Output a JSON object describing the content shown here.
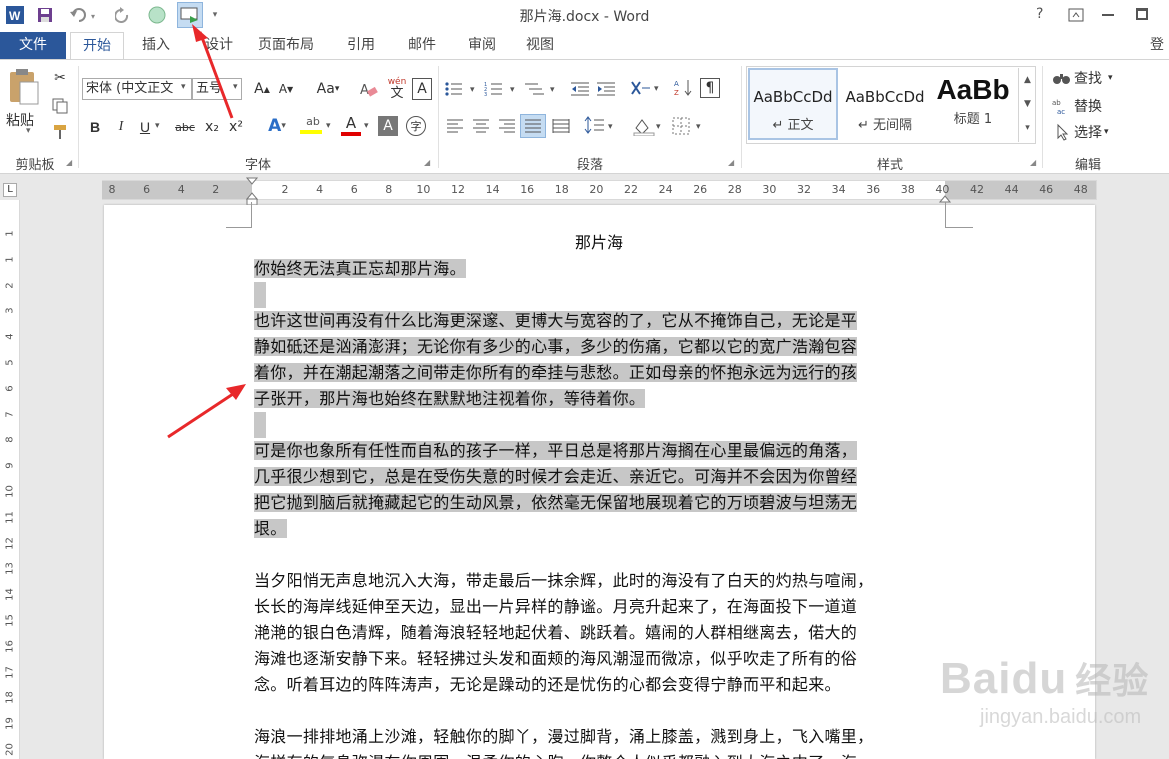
{
  "window": {
    "title": "那片海.docx - Word",
    "help": "?",
    "accent": "#2b579a"
  },
  "tabs": {
    "file": "文件",
    "home": "开始",
    "insert": "插入",
    "design": "设计",
    "layout": "页面布局",
    "references": "引用",
    "mailings": "邮件",
    "review": "审阅",
    "view": "视图",
    "signin": "登"
  },
  "ribbon": {
    "clipboard": {
      "paste": "粘贴",
      "label": "剪贴板"
    },
    "font": {
      "name": "宋体 (中文正文",
      "size": "五号",
      "label": "字体",
      "case_btn": "Aa",
      "wen": "wén",
      "wen_char": "文",
      "boxed_char": "A",
      "enclose_char": "字",
      "bold": "B",
      "italic": "I",
      "underline": "U",
      "strike": "abc",
      "subscript": "x₂",
      "superscript": "x²",
      "effects": "A",
      "highlight": "ab",
      "color": "A",
      "shading": "A",
      "grow": "A",
      "shrink": "A"
    },
    "paragraph": {
      "label": "段落"
    },
    "styles": {
      "label": "样式",
      "items": [
        {
          "sample": "AaBbCcDd",
          "name": "↵ 正文"
        },
        {
          "sample": "AaBbCcDd",
          "name": "↵ 无间隔"
        },
        {
          "sample": "AaBb",
          "name": "标题 1"
        }
      ]
    },
    "editing": {
      "label": "编辑",
      "find": "查找",
      "replace": "替换",
      "select": "选择"
    }
  },
  "ruler": {
    "corner": "L",
    "numbers": [
      "8",
      "6",
      "4",
      "2",
      "2",
      "4",
      "6",
      "8",
      "10",
      "12",
      "14",
      "16",
      "18",
      "20",
      "22",
      "24",
      "26",
      "28",
      "30",
      "32",
      "34",
      "36",
      "38",
      "40",
      "42",
      "44",
      "46",
      "48"
    ],
    "vnumbers": [
      "1",
      "1",
      "2",
      "3",
      "4",
      "5",
      "6",
      "7",
      "8",
      "9",
      "10",
      "11",
      "12",
      "13",
      "14",
      "15",
      "16",
      "17",
      "18",
      "19",
      "20"
    ]
  },
  "document": {
    "title": "那片海",
    "paragraphs": [
      [
        "你始终无法真正忘却那片海。"
      ],
      [
        "也许这世间再没有什么比海更深邃、更博大与宽容的了，它从不掩饰自己，无论是平",
        "静如砥还是汹涌澎湃；无论你有多少的心事，多少的伤痛，它都以它的宽广浩瀚包容",
        "着你，并在潮起潮落之间带走你所有的牵挂与悲愁。正如母亲的怀抱永远为远行的孩",
        "子张开，那片海也始终在默默地注视着你，等待着你。"
      ],
      [
        "可是你也象所有任性而自私的孩子一样，平日总是将那片海搁在心里最偏远的角落，",
        "几乎很少想到它，总是在受伤失意的时候才会走近、亲近它。可海并不会因为你曾经",
        "把它抛到脑后就掩藏起它的生动风景，依然毫无保留地展现着它的万顷碧波与坦荡无",
        "垠。"
      ],
      [
        "当夕阳悄无声息地沉入大海，带走最后一抹余辉，此时的海没有了白天的灼热与喧闹，",
        "长长的海岸线延伸至天边，显出一片异样的静谧。月亮升起来了，在海面投下一道道",
        "滟滟的银白色清辉，随着海浪轻轻地起伏着、跳跃着。嬉闹的人群相继离去，偌大的",
        "海滩也逐渐安静下来。轻轻拂过头发和面颊的海风潮湿而微凉，似乎吹走了所有的俗",
        "念。听着耳边的阵阵涛声，无论是躁动的还是忧伤的心都会变得宁静而平和起来。"
      ],
      [
        "海浪一排排地涌上沙滩，轻触你的脚丫，漫过脚背，涌上膝盖，溅到身上，飞入嘴里，",
        "海样有的气息弥漫在你周围，温柔你的心胸，你整个人似乎都融入到大海之中了。海"
      ]
    ]
  },
  "watermark": {
    "brand": "Baidu",
    "cn": "经验",
    "url": "jingyan.baidu.com"
  }
}
